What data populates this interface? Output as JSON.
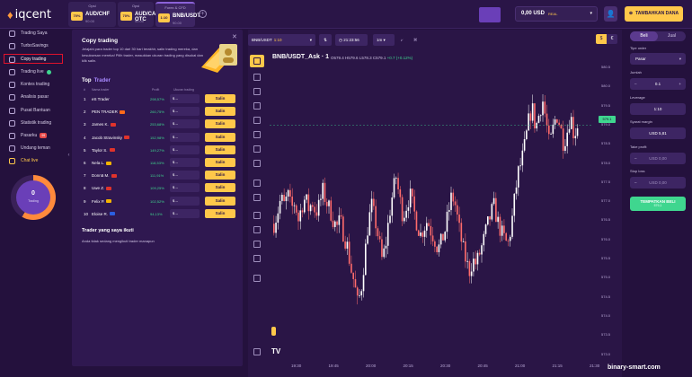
{
  "brand": {
    "logo_mark": "♦",
    "logo_text": "iqcent"
  },
  "asset_tabs": [
    {
      "kind": "Opsi",
      "badge": "70%",
      "name": "AUD/CHF",
      "pct": "90.00"
    },
    {
      "kind": "Opsi",
      "badge": "70%",
      "name": "AUD/CAD OTC",
      "pct": "90.00"
    },
    {
      "kind": "Forex & CFD",
      "badge": "1:10",
      "name": "BNB/USDT",
      "pct": "90.00"
    }
  ],
  "header": {
    "balance": "0,00 USD",
    "account_type": "REAL",
    "deposit_label": "TAMBAHKAN DANA"
  },
  "sidebar": {
    "items": [
      {
        "label": "Trading Saya"
      },
      {
        "label": "TurboSavings"
      },
      {
        "label": "Copy trading"
      },
      {
        "label": "Trading live"
      },
      {
        "label": "Kontes trading"
      },
      {
        "label": "Analisis pasar"
      },
      {
        "label": "Pusat Bantuan"
      },
      {
        "label": "Statistik trading"
      },
      {
        "label": "Pasarku",
        "badge": "99"
      },
      {
        "label": "Undang teman"
      },
      {
        "label": "Chat live"
      }
    ],
    "trading_count": "0",
    "trading_label": "Trading"
  },
  "copy_trading": {
    "title": "Copy trading",
    "description": "Jelajahi para trader top 10 dari 30 hari terakhir, salin trading mereka, dan kesuksesan mereka! Pilih trader, masukkan ukuran trading yang disukai dan klik salin.",
    "top_title": "Top",
    "top_accent": "Trader",
    "headers": {
      "num": "#",
      "name": "Nama trader",
      "profit": "Profit",
      "size": "Ukuran trading"
    },
    "traders": [
      {
        "idx": "1",
        "name": "eS Trader",
        "profit": "298,57%",
        "amount": "$ --",
        "copy": "Salin",
        "flag": ""
      },
      {
        "idx": "2",
        "name": "PEN TRADER",
        "profit": "260,75%",
        "amount": "$ --",
        "copy": "Salin",
        "flag": "#ff6a1a"
      },
      {
        "idx": "3",
        "name": "James K.",
        "profit": "253,68%",
        "amount": "$ --",
        "copy": "Salin",
        "flag": "#e0332b"
      },
      {
        "idx": "4",
        "name": "Jacob Stravinsky",
        "profit": "152,98%",
        "amount": "$ --",
        "copy": "Salin",
        "flag": "#e0332b"
      },
      {
        "idx": "5",
        "name": "Taylor S.",
        "profit": "149,27%",
        "amount": "$ --",
        "copy": "Salin",
        "flag": "#e0332b"
      },
      {
        "idx": "6",
        "name": "Nela L.",
        "profit": "118,53%",
        "amount": "$ --",
        "copy": "Salin",
        "flag": "#f5b400"
      },
      {
        "idx": "7",
        "name": "Donnā M.",
        "profit": "111,91%",
        "amount": "$ --",
        "copy": "Salin",
        "flag": "#e0332b"
      },
      {
        "idx": "8",
        "name": "Uwe Z.",
        "profit": "109,25%",
        "amount": "$ --",
        "copy": "Salin",
        "flag": "#e0332b"
      },
      {
        "idx": "9",
        "name": "Felix P.",
        "profit": "102,52%",
        "amount": "$ --",
        "copy": "Salin",
        "flag": "#f5b400"
      },
      {
        "idx": "10",
        "name": "Eloise R.",
        "profit": "94,13%",
        "amount": "$ --",
        "copy": "Salin",
        "flag": "#2b5fe0"
      }
    ],
    "my_traders_title": "Trader yang saya ikuti",
    "my_traders_empty": "Anda tidak sedang mengikuti trader manapun"
  },
  "chart_toolbar": {
    "asset": "BNB/USDT",
    "asset_lev": "1:10",
    "time": "21:23:56",
    "timeframe": "1m",
    "currency_a": "$",
    "currency_b": "€"
  },
  "chart": {
    "symbol": "BNB/USDT_Ask · 1",
    "ohlc": {
      "o": "O579.4",
      "h": "H579.6",
      "l": "L578.3",
      "c": "C579.1",
      "chg": "+0.7 (+0.12%)"
    },
    "current_price": "579.1",
    "watermark": "TV"
  },
  "chart_data": {
    "type": "candlestick",
    "y_ticks": [
      "580.5",
      "580.0",
      "579.5",
      "579.0",
      "578.5",
      "578.0",
      "577.5",
      "577.0",
      "576.5",
      "576.0",
      "575.5",
      "575.0",
      "574.5",
      "574.0",
      "573.5",
      "573.0"
    ],
    "x_ticks": [
      "19:30",
      "19:45",
      "20:00",
      "20:15",
      "20:30",
      "20:45",
      "21:00",
      "21:15",
      "21:30"
    ],
    "ylim": [
      572.7,
      580.8
    ],
    "close_path": [
      576.4,
      576.7,
      577.1,
      576.9,
      577.2,
      576.8,
      577.0,
      576.5,
      576.9,
      577.1,
      576.8,
      577.0,
      576.7,
      576.9,
      577.3,
      577.0,
      576.8,
      576.5,
      576.3,
      576.5,
      576.1,
      575.8,
      575.2,
      574.8,
      574.2,
      574.6,
      575.5,
      576.4,
      576.9,
      576.5,
      576.0,
      575.4,
      575.8,
      576.6,
      577.2,
      577.7,
      577.1,
      576.6,
      576.9,
      577.2,
      576.8,
      576.4,
      576.1,
      576.3,
      576.5,
      576.2,
      576.0,
      575.7,
      575.9,
      576.2,
      576.7,
      577.2,
      576.9,
      576.3,
      575.8,
      575.4,
      575.1,
      575.4,
      575.3,
      575.6,
      575.9,
      576.3,
      576.6,
      576.9,
      576.5,
      576.2,
      576.0,
      575.8,
      576.3,
      577.1,
      577.8,
      578.1,
      578.6,
      579.2,
      579.6,
      579.0,
      579.4,
      579.8,
      579.2,
      578.5,
      579.0,
      579.4,
      579.1,
      578.6,
      578.9,
      579.4,
      578.8,
      579.1
    ]
  },
  "trade_panel": {
    "buy": "Beli",
    "sell": "Jual",
    "order_type_label": "Tipe order",
    "order_type": "Pasar",
    "amount_label": "Jumlah",
    "amount": "0.1",
    "minus": "–",
    "plus": "+",
    "leverage_label": "Leverage",
    "leverage": "1:10",
    "margin_label": "Syarat margin",
    "margin": "USD 5,81",
    "take_profit_label": "Take profit",
    "take_profit": "USD 0,00",
    "stop_loss_label": "Stop loss",
    "stop_loss": "USD 0,00",
    "place_label": "TEMPATKAN BELI",
    "place_sub": "579,1"
  },
  "watermark": "binary-smart.com"
}
